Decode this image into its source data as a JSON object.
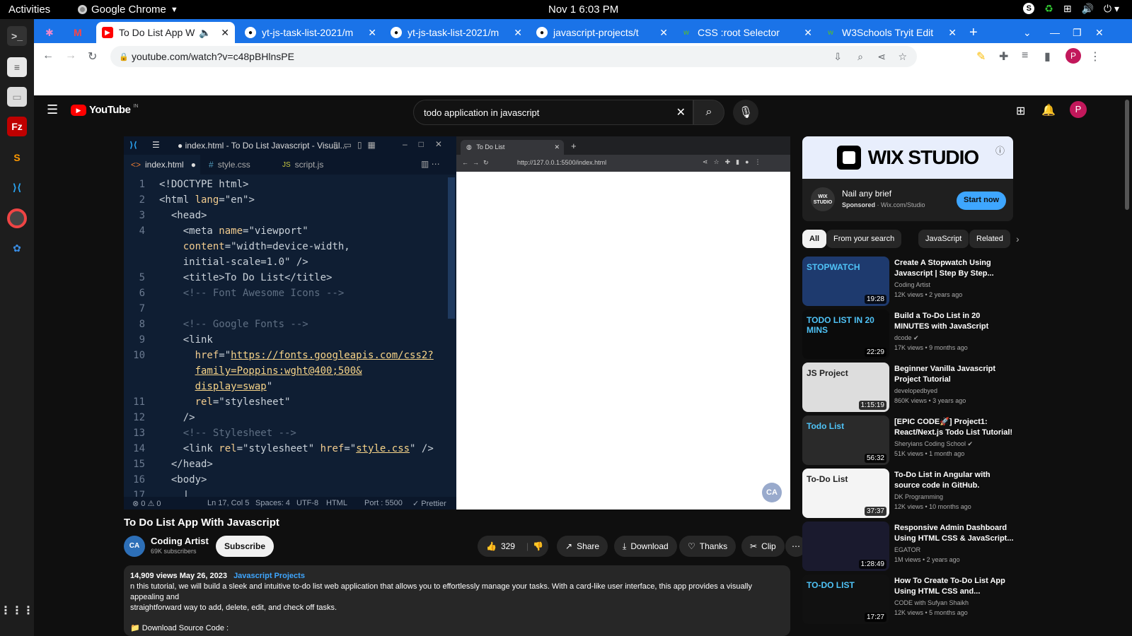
{
  "topbar": {
    "activities": "Activities",
    "app": "Google Chrome",
    "clock": "Nov 1  6:03 PM"
  },
  "tabs": [
    {
      "label": "To Do List App W",
      "active": true
    },
    {
      "label": "yt-js-task-list-2021/m"
    },
    {
      "label": "yt-js-task-list-2021/m"
    },
    {
      "label": "javascript-projects/t"
    },
    {
      "label": "CSS :root Selector"
    },
    {
      "label": "W3Schools Tryit Edit"
    }
  ],
  "address": {
    "url": "youtube.com/watch?v=c48pBHlnsPE"
  },
  "youtube": {
    "logo": "YouTube",
    "logo_region": "IN",
    "search_value": "todo application in javascript",
    "avatar": "P"
  },
  "video": {
    "vscode_title": "● index.html - To Do List Javascript - Visual...",
    "tabs": [
      "index.html",
      "style.css",
      "script.js"
    ],
    "status": [
      "⊗ 0 ⚠ 0",
      "Ln 17, Col 5",
      "Spaces: 4",
      "UTF-8",
      "HTML",
      "Port : 5500",
      "✓ Prettier"
    ],
    "inner_tab": "To Do List",
    "inner_url": "http://127.0.0.1:5500/index.html",
    "code_lines": [
      {
        "n": "1",
        "t": "<!DOCTYPE html>"
      },
      {
        "n": "2",
        "t": "<html lang=\"en\">"
      },
      {
        "n": "3",
        "t": "  <head>"
      },
      {
        "n": "4",
        "t": "    <meta name=\"viewport\""
      },
      {
        "n": "",
        "t": "    content=\"width=device-width,"
      },
      {
        "n": "",
        "t": "    initial-scale=1.0\" />"
      },
      {
        "n": "5",
        "t": "    <title>To Do List</title>"
      },
      {
        "n": "6",
        "t": "    <!-- Font Awesome Icons -->"
      },
      {
        "n": "7",
        "t": ""
      },
      {
        "n": "8",
        "t": "    <!-- Google Fonts -->"
      },
      {
        "n": "9",
        "t": "    <link"
      },
      {
        "n": "10",
        "t": "      href=\"https://fonts.googleapis.com/css2?"
      },
      {
        "n": "",
        "t": "      family=Poppins:wght@400;500&"
      },
      {
        "n": "",
        "t": "      display=swap\""
      },
      {
        "n": "11",
        "t": "      rel=\"stylesheet\""
      },
      {
        "n": "12",
        "t": "    />"
      },
      {
        "n": "13",
        "t": "    <!-- Stylesheet -->"
      },
      {
        "n": "14",
        "t": "    <link rel=\"stylesheet\" href=\"style.css\" />"
      },
      {
        "n": "15",
        "t": "  </head>"
      },
      {
        "n": "16",
        "t": "  <body>"
      },
      {
        "n": "17",
        "t": "    |"
      }
    ]
  },
  "info": {
    "title": "To Do List App With Javascript",
    "channel": "Coding Artist",
    "subs": "69K subscribers",
    "subscribe": "Subscribe",
    "likes": "329",
    "share": "Share",
    "download": "Download",
    "thanks": "Thanks",
    "clip": "Clip",
    "views_date": "14,909 views  May 26, 2023",
    "tag": "Javascript Projects",
    "desc1": "n this tutorial, we will build a sleek and intuitive to-do list web application that allows you to effortlessly manage your tasks. With a card-like user interface, this app provides a visually appealing and",
    "desc2": "straightforward way to add, delete, edit, and check off tasks.",
    "desc3": "📁 Download Source Code :"
  },
  "ad": {
    "brand": "WIX STUDIO",
    "headline": "Nail any brief",
    "sponsored": "Sponsored",
    "domain": "· Wix.com/Studio",
    "cta": "Start now",
    "logo_text": "WIX STUDIO"
  },
  "chips": [
    "All",
    "From your search",
    "JavaScript",
    "Related"
  ],
  "recs": [
    {
      "title": "Create A Stopwatch Using Javascript | Step By Step...",
      "channel": "Coding Artist",
      "meta": "12K views  • 2 years ago",
      "dur": "19:28",
      "thumb_text": "STOPWATCH"
    },
    {
      "title": "Build a To-Do List in 20 MINUTES with JavaScript",
      "channel": "dcode ✔",
      "meta": "17K views  • 9 months ago",
      "dur": "22:29",
      "thumb_text": "TODO LIST IN 20 MINS"
    },
    {
      "title": "Beginner Vanilla Javascript Project Tutorial",
      "channel": "developedbyed",
      "meta": "860K views  • 3 years ago",
      "dur": "1:15:19",
      "thumb_text": "JS Project"
    },
    {
      "title": "[EPIC CODE🚀] Project1: React/Next.js Todo List Tutorial!",
      "channel": "Sheryians Coding School ✔",
      "meta": "51K views  • 1 month ago",
      "dur": "56:32",
      "thumb_text": "Todo List"
    },
    {
      "title": "To-Do List in Angular with source code in GitHub.",
      "channel": "DK Programming",
      "meta": "12K views  • 10 months ago",
      "dur": "37:37",
      "thumb_text": "To-Do List"
    },
    {
      "title": "Responsive Admin Dashboard Using HTML CSS & JavaScript...",
      "channel": "EGATOR",
      "meta": "1M views  • 2 years ago",
      "dur": "1:28:49",
      "thumb_text": ""
    },
    {
      "title": "How To Create To-Do List App Using HTML CSS and...",
      "channel": "CODE with Sufyan Shaikh",
      "meta": "12K views  • 5 months ago",
      "dur": "17:27",
      "thumb_text": "TO-DO LIST"
    }
  ]
}
